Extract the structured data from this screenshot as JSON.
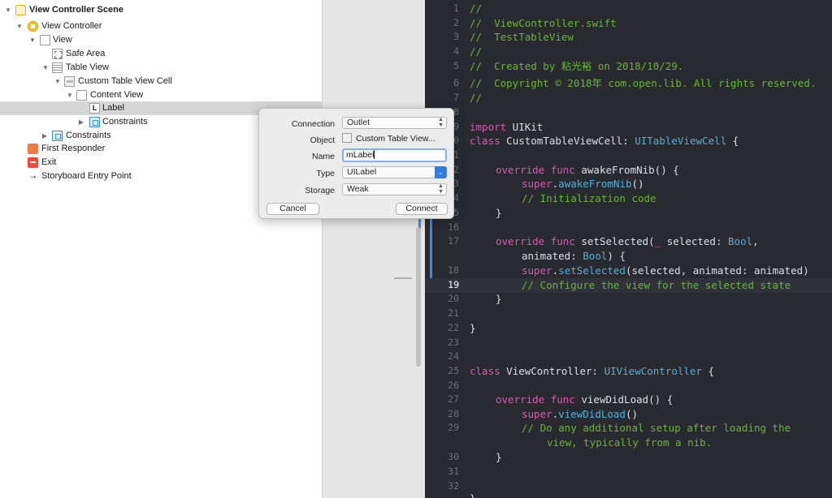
{
  "outline": {
    "items": [
      {
        "label": "View Controller Scene"
      },
      {
        "label": "View Controller"
      },
      {
        "label": "View"
      },
      {
        "label": "Safe Area"
      },
      {
        "label": "Table View"
      },
      {
        "label": "Custom Table View Cell"
      },
      {
        "label": "Content View"
      },
      {
        "label": "Label"
      },
      {
        "label": "Constraints"
      },
      {
        "label": "Constraints"
      },
      {
        "label": "First Responder"
      },
      {
        "label": "Exit"
      },
      {
        "label": "Storyboard Entry Point"
      }
    ]
  },
  "popover": {
    "connection_label": "Connection",
    "connection_value": "Outlet",
    "object_label": "Object",
    "object_value": "Custom Table View...",
    "name_label": "Name",
    "name_value": "mLabel",
    "type_label": "Type",
    "type_value": "UILabel",
    "storage_label": "Storage",
    "storage_value": "Weak",
    "cancel_label": "Cancel",
    "connect_label": "Connect"
  },
  "editor": {
    "current_line": "19",
    "lines": [
      {
        "num": "1"
      },
      {
        "num": "2"
      },
      {
        "num": "3"
      },
      {
        "num": "4"
      },
      {
        "num": "5"
      },
      {
        "num": "6"
      },
      {
        "num": "7"
      },
      {
        "num": "8"
      },
      {
        "num": "9"
      },
      {
        "num": "10"
      },
      {
        "num": "11"
      },
      {
        "num": "12"
      },
      {
        "num": "13"
      },
      {
        "num": "14"
      },
      {
        "num": "15"
      },
      {
        "num": "16"
      },
      {
        "num": "17"
      },
      {
        "num": ""
      },
      {
        "num": "18"
      },
      {
        "num": "19"
      },
      {
        "num": "20"
      },
      {
        "num": "21"
      },
      {
        "num": "22"
      },
      {
        "num": "23"
      },
      {
        "num": "24"
      },
      {
        "num": "25"
      },
      {
        "num": "26"
      },
      {
        "num": "27"
      },
      {
        "num": "28"
      },
      {
        "num": "29"
      },
      {
        "num": ""
      },
      {
        "num": "30"
      },
      {
        "num": "31"
      },
      {
        "num": "32"
      }
    ],
    "code": {
      "l1": "//",
      "l2": "//  ViewController.swift",
      "l3": "//  TestTableView",
      "l4": "//",
      "l5": "//  Created by 粘光裕 on 2018/10/29.",
      "l6": "//  Copyright © 2018年 com.open.lib. All rights reserved.",
      "l7": "//",
      "l9_kw": "import",
      "l9_rest": " UIKit",
      "l10_kw": "class",
      "l10_name": " CustomTableViewCell: ",
      "l10_type": "UITableViewCell",
      "l10_end": " {",
      "l12_kw": "override func",
      "l12_rest": " awakeFromNib() {",
      "l13_kw": "super",
      "l13_dot": ".",
      "l13_call": "awakeFromNib",
      "l13_end": "()",
      "l14": "// Initialization code",
      "l15": "}",
      "l17_kw": "override func",
      "l17_rest": " setSelected(",
      "l17_us": "_",
      "l17_rest2": " selected: ",
      "l17_type": "Bool",
      "l17_end": ",",
      "l17b_rest": "animated: ",
      "l17b_type": "Bool",
      "l17b_end": ") {",
      "l18_kw": "super",
      "l18_dot": ".",
      "l18_call": "setSelected",
      "l18_rest": "(selected, animated: animated)",
      "l19": "// Configure the view for the selected state",
      "l20": "}",
      "l22": "}",
      "l25_kw": "class",
      "l25_name": " ViewController: ",
      "l25_type": "UIViewController",
      "l25_end": " {",
      "l27_kw": "override func",
      "l27_rest": " viewDidLoad() {",
      "l28_kw": "super",
      "l28_dot": ".",
      "l28_call": "viewDidLoad",
      "l28_end": "()",
      "l29": "// Do any additional setup after loading the",
      "l29b": "view, typically from a nib.",
      "l30": "}",
      "l32": "}"
    }
  },
  "colors": {
    "editor_bg": "#292a30",
    "comment": "#67b732",
    "keyword": "#d75ab0",
    "type": "#4fb0d8",
    "accent": "#3d8ed9"
  }
}
